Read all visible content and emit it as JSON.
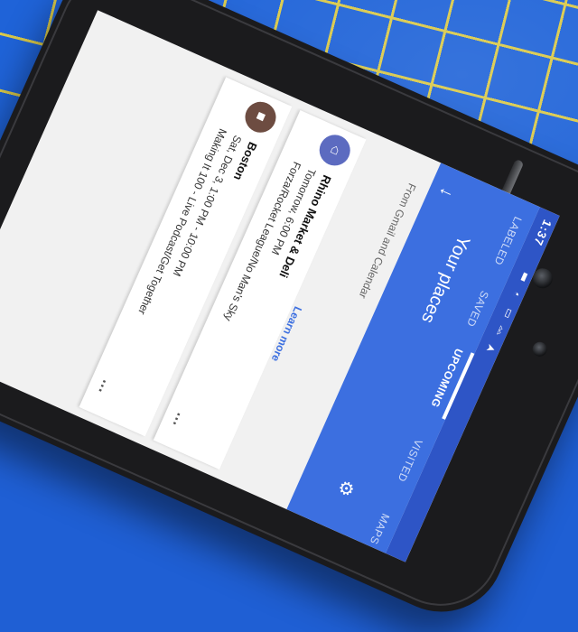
{
  "status_bar": {
    "time": "1:37",
    "icons": [
      "location-icon",
      "bluetooth-icon",
      "vibrate-icon",
      "wifi-icon",
      "signal-icon"
    ]
  },
  "app_bar": {
    "title": "Your places",
    "back_icon": "arrow-back-icon"
  },
  "tabs": [
    {
      "label": "LABELED",
      "active": false
    },
    {
      "label": "SAVED",
      "active": false
    },
    {
      "label": "UPCOMING",
      "active": true
    },
    {
      "label": "VISITED",
      "active": false
    },
    {
      "label": "MAPS",
      "active": false
    }
  ],
  "settings_icon": "gear-icon",
  "source_text": "From Gmail and Calendar",
  "learn_more": "Learn more",
  "items": [
    {
      "title": "Rhino Market & Deli",
      "time": "Tomorrow, 6:00 PM",
      "subtitle": "Forza/Rocket League/No Man's Sky",
      "avatar_color": "#5c6bc0",
      "avatar_icon": "restaurant-icon"
    },
    {
      "title": "Boston",
      "time": "Sat, Dec 3, 1:00 PM - 10:00 PM",
      "subtitle": "Making It 100 - Live Podcast/Get Together",
      "avatar_color": "#6d4c41",
      "avatar_icon": "place-icon"
    }
  ],
  "colors": {
    "accent": "#3c6fe0",
    "mat": "#1f63d8",
    "grid": "#d9c94a"
  }
}
